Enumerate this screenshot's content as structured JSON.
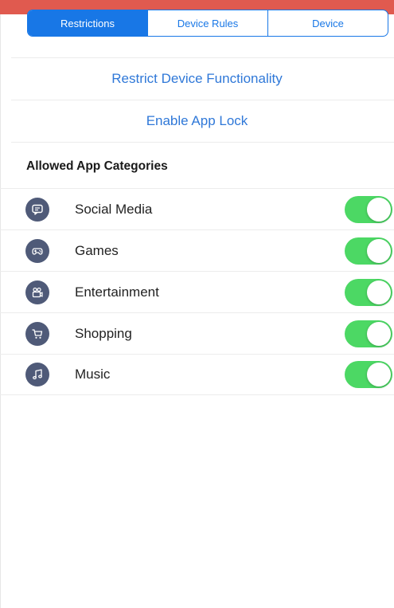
{
  "tabs": [
    {
      "label": "Restrictions",
      "active": true
    },
    {
      "label": "Device Rules",
      "active": false
    },
    {
      "label": "Device",
      "active": false
    }
  ],
  "actions": {
    "restrict_label": "Restrict Device Functionality",
    "app_lock_label": "Enable App Lock"
  },
  "section": {
    "title": "Allowed App Categories"
  },
  "categories": [
    {
      "label": "Social Media",
      "icon": "chat-icon",
      "enabled": true
    },
    {
      "label": "Games",
      "icon": "gamepad-icon",
      "enabled": true
    },
    {
      "label": "Entertainment",
      "icon": "video-camera-icon",
      "enabled": true
    },
    {
      "label": "Shopping",
      "icon": "shopping-cart-icon",
      "enabled": true
    },
    {
      "label": "Music",
      "icon": "music-note-icon",
      "enabled": true
    }
  ],
  "colors": {
    "accent": "#1877e6",
    "link": "#2f78d8",
    "toggle_on": "#4cd864",
    "icon_bg": "#4f5a78",
    "top_bar": "#e05a4f"
  }
}
